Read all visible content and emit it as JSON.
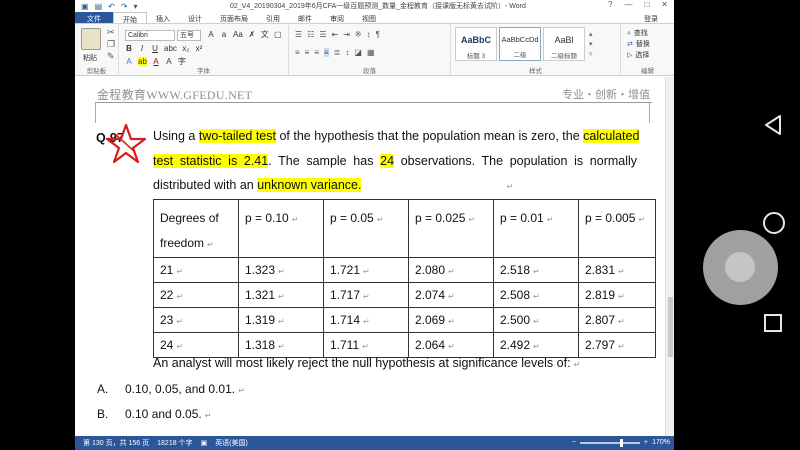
{
  "window": {
    "title": "02_V4_20190304_2019年6月CFA一级百题预测_数量_金程教育（接课版无标黄去试阶）- Word",
    "controls": [
      "?",
      "—",
      "□",
      "✕"
    ]
  },
  "quick_access": {
    "save_icon": "save-icon",
    "undo_icon": "undo-icon",
    "redo_icon": "redo-icon"
  },
  "tabs": [
    {
      "label": "文件",
      "kind": "file"
    },
    {
      "label": "开始",
      "kind": "active"
    },
    {
      "label": "插入",
      "kind": "normal"
    },
    {
      "label": "设计",
      "kind": "normal"
    },
    {
      "label": "页面布局",
      "kind": "normal"
    },
    {
      "label": "引用",
      "kind": "normal"
    },
    {
      "label": "邮件",
      "kind": "normal"
    },
    {
      "label": "审阅",
      "kind": "normal"
    },
    {
      "label": "视图",
      "kind": "normal"
    }
  ],
  "login_label": "登录",
  "ribbon": {
    "clipboard": {
      "paste_label": "粘贴",
      "group_label": "剪贴板"
    },
    "font": {
      "font_name": "Calibri",
      "font_size": "五号",
      "group_label": "字体"
    },
    "paragraph": {
      "group_label": "段落"
    },
    "styles": {
      "group_label": "样式",
      "items": [
        {
          "sample": "AaBbC",
          "name": "标题 3"
        },
        {
          "sample": "AaBbCcDd",
          "name": "二级"
        },
        {
          "sample": "AaBl",
          "name": "二级标题"
        }
      ]
    },
    "editing": {
      "group_label": "编辑",
      "items": [
        "查找",
        "替换",
        "选择"
      ]
    }
  },
  "document": {
    "header_left": "金程教育WWW.GFEDU.NET",
    "header_right": "专业・创新・增值",
    "question_number": "Q-97",
    "question_lines": [
      [
        {
          "t": "Using a ",
          "hl": false
        },
        {
          "t": "two-tailed test",
          "hl": true
        },
        {
          "t": " of the hypothesis that the population mean is zero, the ",
          "hl": false
        },
        {
          "t": "calculated",
          "hl": true
        }
      ],
      [
        {
          "t": "test statistic is 2.41",
          "hl": true
        },
        {
          "t": ". The sample has ",
          "hl": false
        },
        {
          "t": "24",
          "hl": true
        },
        {
          "t": " observations. The population is normally",
          "hl": false
        }
      ],
      [
        {
          "t": "distributed with an ",
          "hl": false
        },
        {
          "t": "unknown variance.",
          "hl": true
        }
      ]
    ],
    "table": {
      "header": [
        "Degrees of freedom",
        "p = 0.10",
        "p = 0.05",
        "p = 0.025",
        "p = 0.01",
        "p = 0.005"
      ],
      "rows": [
        [
          "21",
          "1.323",
          "1.721",
          "2.080",
          "2.518",
          "2.831"
        ],
        [
          "22",
          "1.321",
          "1.717",
          "2.074",
          "2.508",
          "2.819"
        ],
        [
          "23",
          "1.319",
          "1.714",
          "2.069",
          "2.500",
          "2.807"
        ],
        [
          "24",
          "1.318",
          "1.711",
          "2.064",
          "2.492",
          "2.797"
        ]
      ]
    },
    "prompt": "An analyst will most likely reject the null hypothesis at significance levels of:",
    "options": [
      {
        "letter": "A.",
        "text": "0.10, 0.05, and 0.01."
      },
      {
        "letter": "B.",
        "text": "0.10 and 0.05."
      }
    ]
  },
  "status_bar": {
    "page": "第 130 页，共 156 页",
    "words": "18218 个字",
    "language": "英语(美国)",
    "zoom": "170%",
    "zoom_level": 0.7
  }
}
